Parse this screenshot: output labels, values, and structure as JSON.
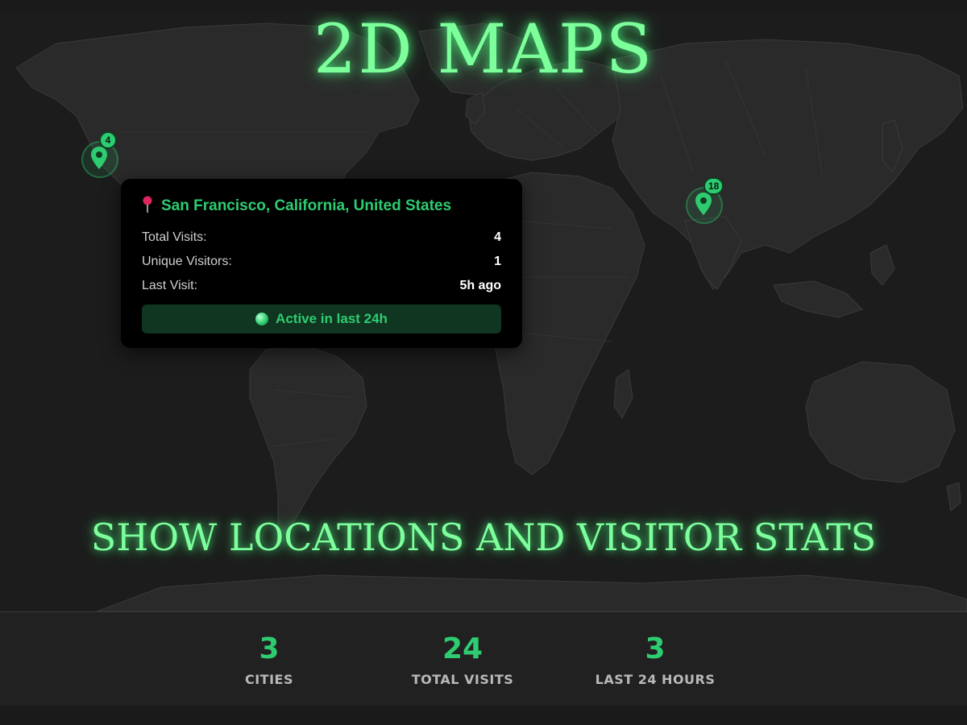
{
  "header": {
    "title": "2D MAPS",
    "subtitle": "SHOW LOCATIONS AND VISITOR STATS"
  },
  "map": {
    "markers": [
      {
        "count": "4",
        "label": "San Francisco marker"
      },
      {
        "count": "18",
        "label": "India marker"
      }
    ]
  },
  "popup": {
    "location": "San Francisco, California, United States",
    "rows": [
      {
        "label": "Total Visits:",
        "value": "4"
      },
      {
        "label": "Unique Visitors:",
        "value": "1"
      },
      {
        "label": "Last Visit:",
        "value": "5h ago"
      }
    ],
    "status": "Active in last 24h"
  },
  "stats": [
    {
      "value": "3",
      "label": "CITIES"
    },
    {
      "value": "24",
      "label": "TOTAL VISITS"
    },
    {
      "value": "3",
      "label": "LAST 24 HOURS"
    }
  ],
  "colors": {
    "accent": "#2ecc71",
    "glow_text": "#7dff9c",
    "background": "#1a1a1a",
    "land": "#2a2a2a"
  }
}
